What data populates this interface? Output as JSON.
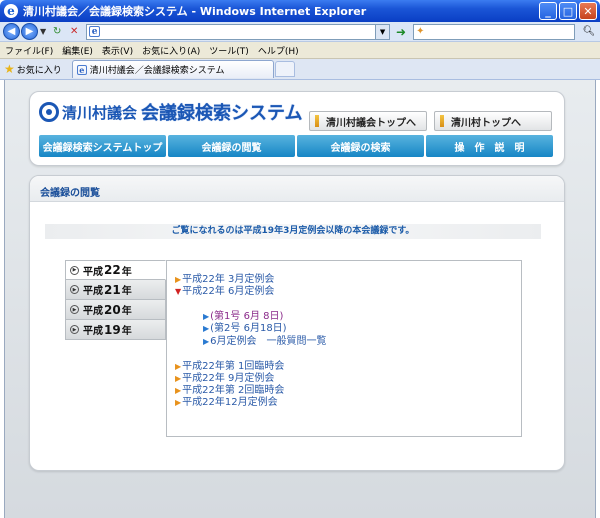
{
  "window": {
    "title": "清川村議会／会議録検索システム - Windows Internet Explorer",
    "minimize_label": "_",
    "maximize_label": "□",
    "close_label": "✕"
  },
  "address_bar": {
    "value": "",
    "page_icon_glyph": "e"
  },
  "search_box": {
    "value": ""
  },
  "menu": {
    "items": [
      "ファイル(F)",
      "編集(E)",
      "表示(V)",
      "お気に入り(A)",
      "ツール(T)",
      "ヘルプ(H)"
    ]
  },
  "favorites_label": "お気に入り",
  "tab": {
    "label": "清川村議会／会議録検索システム"
  },
  "site": {
    "logo_prefix": "清川村議会",
    "logo_main": "会議録検索システム",
    "top_buttons": [
      "清川村議会トップへ",
      "清川村トップへ"
    ],
    "nav_buttons": [
      "会議録検索システムトップ",
      "会議録の閲覧",
      "会議録の検索",
      "操　作　説　明"
    ]
  },
  "section": {
    "title": "会議録の閲覧",
    "notice": "ご覧になれるのは平成19年3月定例会以降の本会議録です。"
  },
  "years": [
    {
      "prefix": "平成",
      "num": "22",
      "suffix": "年"
    },
    {
      "prefix": "平成",
      "num": "21",
      "suffix": "年"
    },
    {
      "prefix": "平成",
      "num": "20",
      "suffix": "年"
    },
    {
      "prefix": "平成",
      "num": "19",
      "suffix": "年"
    }
  ],
  "meetings_top": [
    "平成22年 3月定例会",
    "平成22年 6月定例会"
  ],
  "sub_items": [
    "(第1号 6月 8日)",
    "(第2号 6月18日)",
    "6月定例会　一般質問一覧"
  ],
  "meetings_bottom": [
    "平成22年第 1回臨時会",
    "平成22年 9月定例会",
    "平成22年第 2回臨時会",
    "平成22年12月定例会"
  ],
  "colors": {
    "accent_blue": "#1b57b5",
    "nav_button": "#1686c5",
    "link": "#2b5ba8",
    "current_link": "#8a2a8a"
  }
}
